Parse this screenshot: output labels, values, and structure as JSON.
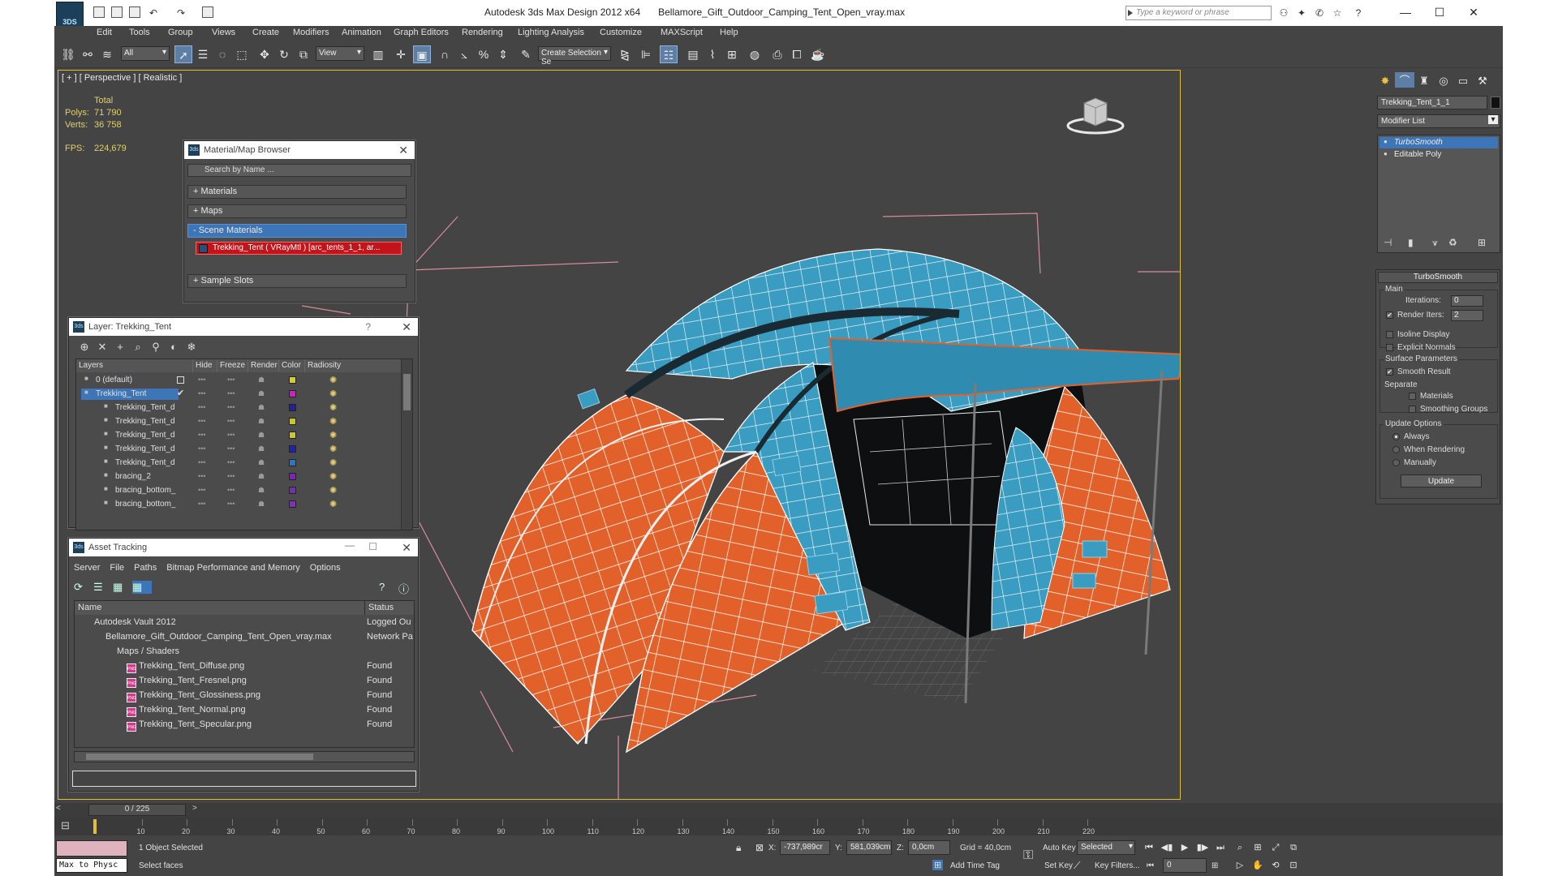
{
  "window": {
    "app_name": "Autodesk 3ds Max Design 2012 x64",
    "file_name": "Bellamore_Gift_Outdoor_Camping_Tent_Open_vray.max",
    "search_placeholder": "Type a keyword or phrase",
    "logo_text": "3DS"
  },
  "menu": [
    "Edit",
    "Tools",
    "Group",
    "Views",
    "Create",
    "Modifiers",
    "Animation",
    "Graph Editors",
    "Rendering",
    "Lighting Analysis",
    "Customize",
    "MAXScript",
    "Help"
  ],
  "toolbar": {
    "selection_filter": "All",
    "ref_coord": "View",
    "named_selection": "Create Selection Se"
  },
  "viewport": {
    "label": "[ + ] [ Perspective ] [ Realistic ]",
    "stats_header": "Total",
    "polys_label": "Polys:",
    "polys_value": "71 790",
    "verts_label": "Verts:",
    "verts_value": "36 758",
    "fps_label": "FPS:",
    "fps_value": "224,679"
  },
  "material_browser": {
    "title": "Material/Map Browser",
    "search_placeholder": "Search by Name ...",
    "rollouts": [
      "+ Materials",
      "+ Maps",
      "- Scene Materials",
      "+ Sample Slots"
    ],
    "scene_material": "Trekking_Tent  ( VRayMtl )  [arc_tents_1_1, ar..."
  },
  "layer_window": {
    "title": "Layer: Trekking_Tent",
    "help": "?",
    "columns": [
      "Layers",
      "Hide",
      "Freeze",
      "Render",
      "Color",
      "Radiosity"
    ],
    "rows": [
      {
        "name": "0 (default)",
        "color": "#d8d020",
        "child": false,
        "selected": false
      },
      {
        "name": "Trekking_Tent",
        "color": "#d020c0",
        "child": false,
        "selected": true
      },
      {
        "name": "Trekking_Tent_d",
        "color": "#2020a0",
        "child": true,
        "selected": false
      },
      {
        "name": "Trekking_Tent_d",
        "color": "#c8c820",
        "child": true,
        "selected": false
      },
      {
        "name": "Trekking_Tent_d",
        "color": "#c8c830",
        "child": true,
        "selected": false
      },
      {
        "name": "Trekking_Tent_d",
        "color": "#2020c0",
        "child": true,
        "selected": false
      },
      {
        "name": "Trekking_Tent_d",
        "color": "#2878c8",
        "child": true,
        "selected": false
      },
      {
        "name": "bracing_2",
        "color": "#8020c0",
        "child": true,
        "selected": false
      },
      {
        "name": "bracing_bottom_",
        "color": "#7030b0",
        "child": true,
        "selected": false
      },
      {
        "name": "bracing_bottom_",
        "color": "#8030c0",
        "child": true,
        "selected": false
      }
    ]
  },
  "asset_tracking": {
    "title": "Asset Tracking",
    "menu": [
      "Server",
      "File",
      "Paths",
      "Bitmap Performance and Memory",
      "Options"
    ],
    "col_name": "Name",
    "col_status": "Status",
    "rows": [
      {
        "name": "Autodesk Vault 2012",
        "status": "Logged Ou",
        "indent": 1,
        "png": false
      },
      {
        "name": "Bellamore_Gift_Outdoor_Camping_Tent_Open_vray.max",
        "status": "Network Pa",
        "indent": 2,
        "png": false
      },
      {
        "name": "Maps / Shaders",
        "status": "",
        "indent": 3,
        "png": false
      },
      {
        "name": "Trekking_Tent_Diffuse.png",
        "status": "Found",
        "indent": 4,
        "png": true
      },
      {
        "name": "Trekking_Tent_Fresnel.png",
        "status": "Found",
        "indent": 4,
        "png": true
      },
      {
        "name": "Trekking_Tent_Glossiness.png",
        "status": "Found",
        "indent": 4,
        "png": true
      },
      {
        "name": "Trekking_Tent_Normal.png",
        "status": "Found",
        "indent": 4,
        "png": true
      },
      {
        "name": "Trekking_Tent_Specular.png",
        "status": "Found",
        "indent": 4,
        "png": true
      }
    ]
  },
  "command_panel": {
    "object_name": "Trekking_Tent_1_1",
    "modifier_list": "Modifier List",
    "stack": [
      "TurboSmooth",
      "Editable Poly"
    ],
    "rollout_title": "TurboSmooth",
    "main_group": "Main",
    "iterations_label": "Iterations:",
    "iterations_value": "0",
    "render_iters_label": "Render Iters:",
    "render_iters_value": "2",
    "isoline": "Isoline Display",
    "explicit_normals": "Explicit Normals",
    "surface_group": "Surface Parameters",
    "smooth_result": "Smooth Result",
    "separate": "Separate",
    "materials": "Materials",
    "smoothing_groups": "Smoothing Groups",
    "update_group": "Update Options",
    "always": "Always",
    "when_rendering": "When Rendering",
    "manually": "Manually",
    "update_button": "Update"
  },
  "timeline": {
    "frame": "0 / 225",
    "ticks": [
      "10",
      "20",
      "30",
      "40",
      "50",
      "60",
      "70",
      "80",
      "90",
      "100",
      "110",
      "120",
      "130",
      "140",
      "150",
      "160",
      "170",
      "180",
      "190",
      "200",
      "210",
      "220"
    ]
  },
  "status": {
    "max_to_physc": "Max to Physc",
    "selected_count": "1 Object Selected",
    "prompt": "Select faces",
    "x_label": "X:",
    "x_value": "-737,989cr",
    "y_label": "Y:",
    "y_value": "581,039cm",
    "z_label": "Z:",
    "z_value": "0,0cm",
    "grid": "Grid = 40,0cm",
    "auto_key": "Auto Key",
    "set_key": "Set Key",
    "selected_dropdown": "Selected",
    "key_filters": "Key Filters...",
    "add_time_tag": "Add Time Tag",
    "current_frame": "0"
  },
  "colors": {
    "tent_orange": "#e2612a",
    "tent_blue": "#3a9cc0",
    "selection_blue": "#3c75b8",
    "viewport_border": "#e0c032"
  }
}
